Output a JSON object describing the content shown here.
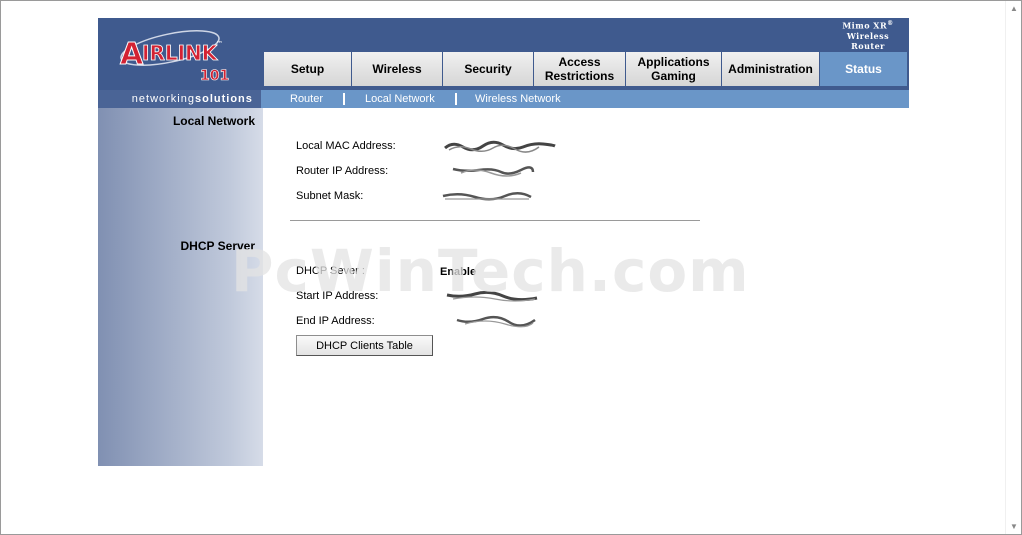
{
  "brand": {
    "logo_text": "AIRLINK",
    "logo_tm": "™",
    "logo_number": "101",
    "tagline_prefix": "networking",
    "tagline_suffix": "solutions",
    "product_line1": "Mimo XR",
    "product_line1_mark": "®",
    "product_line2": "Wireless Router",
    "logo_red": "#d32233",
    "header_blue": "#3f5a8e",
    "accent_blue": "#6a96c8"
  },
  "tabs": [
    {
      "label": "Setup",
      "active": false
    },
    {
      "label": "Wireless",
      "active": false
    },
    {
      "label": "Security",
      "active": false
    },
    {
      "label": "Access\nRestrictions",
      "active": false
    },
    {
      "label": "Applications\nGaming",
      "active": false
    },
    {
      "label": "Administration",
      "active": false
    },
    {
      "label": "Status",
      "active": true
    }
  ],
  "subnav": [
    "Router",
    "Local Network",
    "Wireless Network"
  ],
  "sections": {
    "local_network_title": "Local Network",
    "dhcp_server_title": "DHCP Server"
  },
  "local_network": {
    "mac_label": "Local MAC Address:",
    "router_ip_label": "Router IP Address:",
    "subnet_label": "Subnet Mask:"
  },
  "dhcp": {
    "server_label": "DHCP Sever :",
    "server_value": "Enable",
    "start_ip_label": "Start IP Address:",
    "end_ip_label": "End IP Address:",
    "clients_button": "DHCP Clients Table"
  },
  "watermark": "PcWinTech.com"
}
